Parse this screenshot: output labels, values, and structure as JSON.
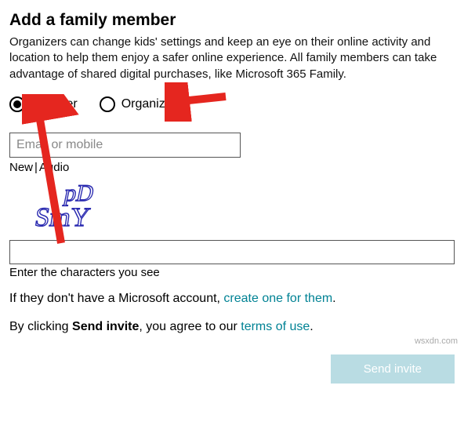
{
  "title": "Add a family member",
  "description": "Organizers can change kids' settings and keep an eye on their online activity and location to help them enjoy a safer online experience. All family members can take advantage of shared digital purchases, like Microsoft 365 Family.",
  "role": {
    "member_label": "Member",
    "organizer_label": "Organizer",
    "selected": "member"
  },
  "email_field": {
    "placeholder": "Email or mobile",
    "value": ""
  },
  "captcha": {
    "new_label": "New",
    "separator": " | ",
    "audio_label": "Audio",
    "text": "pD SmY",
    "hint": "Enter the characters you see",
    "value": ""
  },
  "no_account": {
    "prefix": "If they don't have a Microsoft account, ",
    "link": "create one for them",
    "suffix": "."
  },
  "terms": {
    "prefix": "By clicking ",
    "bold": "Send invite",
    "middle": ", you agree to our ",
    "link": "terms of use",
    "suffix": "."
  },
  "submit_label": "Send invite",
  "watermark": "wsxdn.com",
  "annotation_color": "#e5261f"
}
